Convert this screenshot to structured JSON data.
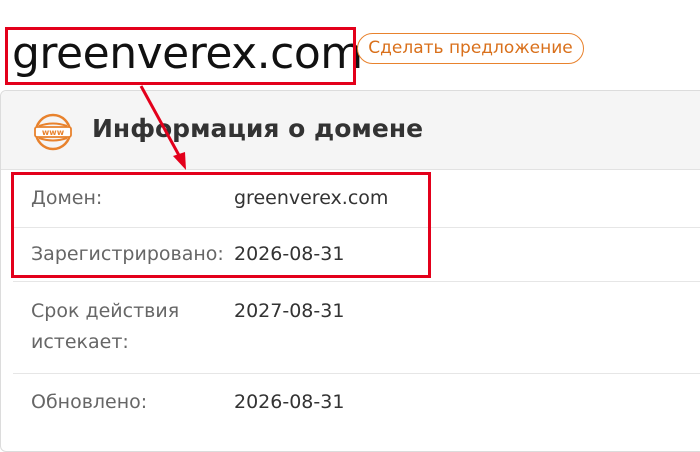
{
  "header": {
    "domain": "greenverex.com",
    "offer_button": "Сделать предложение"
  },
  "card": {
    "icon": "www-icon",
    "title": "Информация о домене",
    "rows": [
      {
        "label": "Домен:",
        "value": "greenverex.com"
      },
      {
        "label": "Зарегистрировано:",
        "value": "2026-08-31"
      },
      {
        "label": "Срок действия истекает:",
        "value": "2027-08-31"
      },
      {
        "label": "Обновлено:",
        "value": "2026-08-31"
      }
    ]
  },
  "colors": {
    "accent": "#e8822d",
    "highlight": "#e3001b"
  }
}
